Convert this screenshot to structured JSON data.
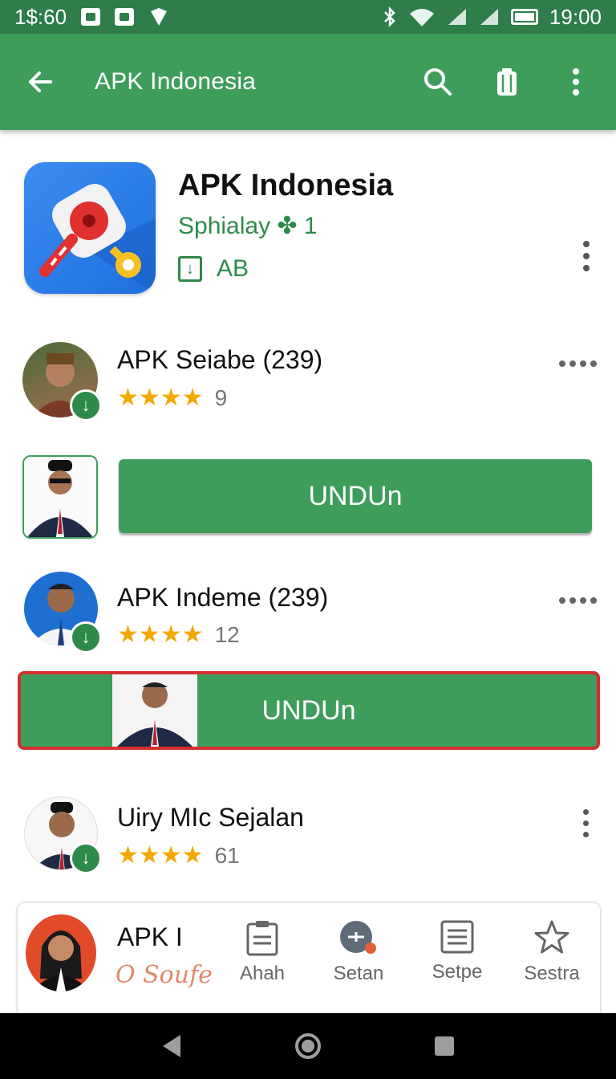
{
  "status_bar": {
    "left_text": "1$:60",
    "time": "19:00"
  },
  "app_bar": {
    "title": "APK Indonesia"
  },
  "app_header": {
    "title": "APK Indonesia",
    "subtitle": "Sphialay ✤ 1",
    "badge_text": "AB"
  },
  "list": [
    {
      "name": "APK Seiabe (239)",
      "stars": "★★★★",
      "count": "9"
    },
    {
      "name": "APK Indeme (239)",
      "stars": "★★★★",
      "count": "12"
    },
    {
      "name": "Uiry MIc Sejalan",
      "stars": "★★★★",
      "count": "61"
    }
  ],
  "download_buttons": [
    {
      "label": "UNDUn"
    },
    {
      "label": "UNDUn"
    }
  ],
  "bottom_card": {
    "title": "APK I",
    "subtitle": "O Soufe",
    "nav": [
      {
        "label": "Ahah",
        "icon": "clipboard-icon"
      },
      {
        "label": "Setan",
        "icon": "add-circle-icon"
      },
      {
        "label": "Setpe",
        "icon": "list-icon"
      },
      {
        "label": "Sestra",
        "icon": "star-outline-icon"
      }
    ]
  },
  "colors": {
    "brand_green": "#3f9d5c",
    "status_green": "#2e7d4a",
    "star": "#f4a800",
    "highlight_red": "#d32f2f"
  }
}
